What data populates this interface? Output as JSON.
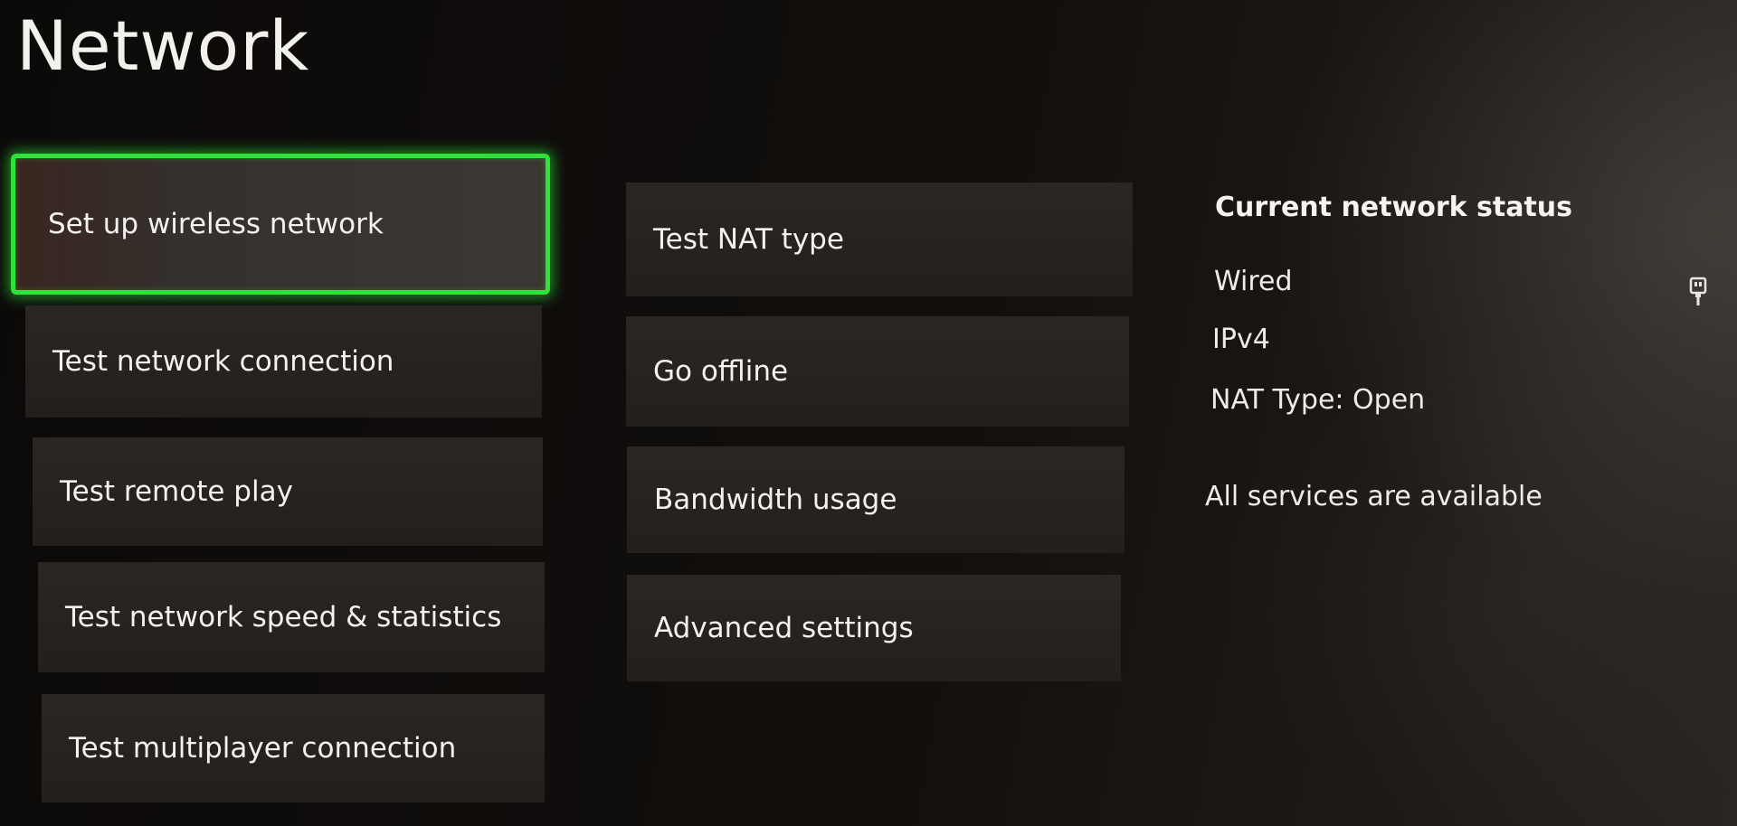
{
  "page": {
    "title": "Network"
  },
  "left_column": [
    {
      "label": "Set up wireless network",
      "focused": true
    },
    {
      "label": "Test network connection"
    },
    {
      "label": "Test remote play"
    },
    {
      "label": "Test network speed & statistics"
    },
    {
      "label": "Test multiplayer connection"
    }
  ],
  "middle_column": [
    {
      "label": "Test NAT type"
    },
    {
      "label": "Go offline"
    },
    {
      "label": "Bandwidth usage"
    },
    {
      "label": "Advanced settings"
    }
  ],
  "status": {
    "heading": "Current network status",
    "connection": "Wired",
    "connection_icon": "ethernet-plug-icon",
    "ip_version": "IPv4",
    "nat_type": "NAT Type: Open",
    "services": "All services are available"
  },
  "colors": {
    "focus_ring": "#2ee23a",
    "tile_background": "#2b2623",
    "text": "#f4f2ef"
  }
}
